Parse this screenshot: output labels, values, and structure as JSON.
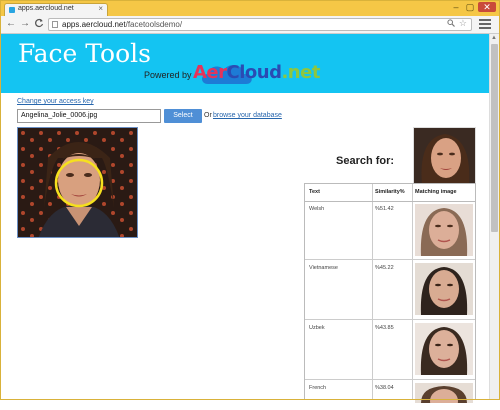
{
  "browser": {
    "tab_title": "apps.aercloud.net",
    "tab_close": "×",
    "url_host": "apps.aercloud.net",
    "url_path": "/facetoolsdemo/",
    "win_min": "–",
    "win_max": "▢",
    "win_close": "✕",
    "back": "←",
    "forward": "→",
    "reload": "C"
  },
  "banner": {
    "title": "Face Tools",
    "powered_by": "Powered by",
    "logo_aer": "Aer",
    "logo_cloud": "Cloud",
    "logo_net": ".net",
    "bg_color": "#14c4f2"
  },
  "controls": {
    "access_key_link": "Change your access key",
    "file_value": "Angelina_Jolie_0006.jpg",
    "select_label": "Select",
    "or_text": "Or",
    "browse_link": "browse your database"
  },
  "search": {
    "label": "Search for:"
  },
  "results": {
    "columns": [
      "Text",
      "Similarity%",
      "Matching image"
    ],
    "rows": [
      {
        "text": "Welsh",
        "similarity": "%51.42"
      },
      {
        "text": "Vietnamese",
        "similarity": "%45.22"
      },
      {
        "text": "Uzbek",
        "similarity": "%43.85"
      },
      {
        "text": "French",
        "similarity": "%38.04"
      }
    ]
  }
}
